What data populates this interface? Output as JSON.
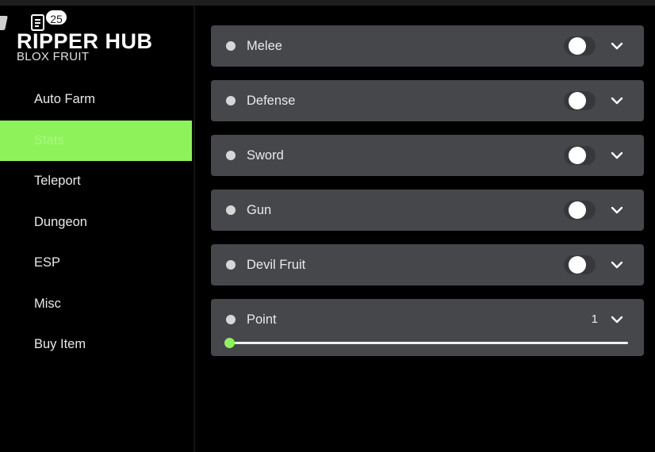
{
  "header": {
    "title": "RIPPER HUB",
    "subtitle": "BLOX FRUIT",
    "notification_count": "25",
    "notification_icon": "notes-icon"
  },
  "sidebar": {
    "items": [
      {
        "label": "Auto Farm",
        "active": false
      },
      {
        "label": "Stats",
        "active": true
      },
      {
        "label": "Teleport",
        "active": false
      },
      {
        "label": "Dungeon",
        "active": false
      },
      {
        "label": "ESP",
        "active": false
      },
      {
        "label": "Misc",
        "active": false
      },
      {
        "label": "Buy Item",
        "active": false
      }
    ]
  },
  "stats": {
    "rows": [
      {
        "label": "Melee",
        "enabled": false
      },
      {
        "label": "Defense",
        "enabled": false
      },
      {
        "label": "Sword",
        "enabled": false
      },
      {
        "label": "Gun",
        "enabled": false
      },
      {
        "label": "Devil Fruit",
        "enabled": false
      }
    ],
    "point": {
      "label": "Point",
      "value": "1",
      "fraction": 0
    }
  },
  "colors": {
    "accent": "#8ef35a",
    "panel_row": "#45474b",
    "background": "#000000"
  }
}
